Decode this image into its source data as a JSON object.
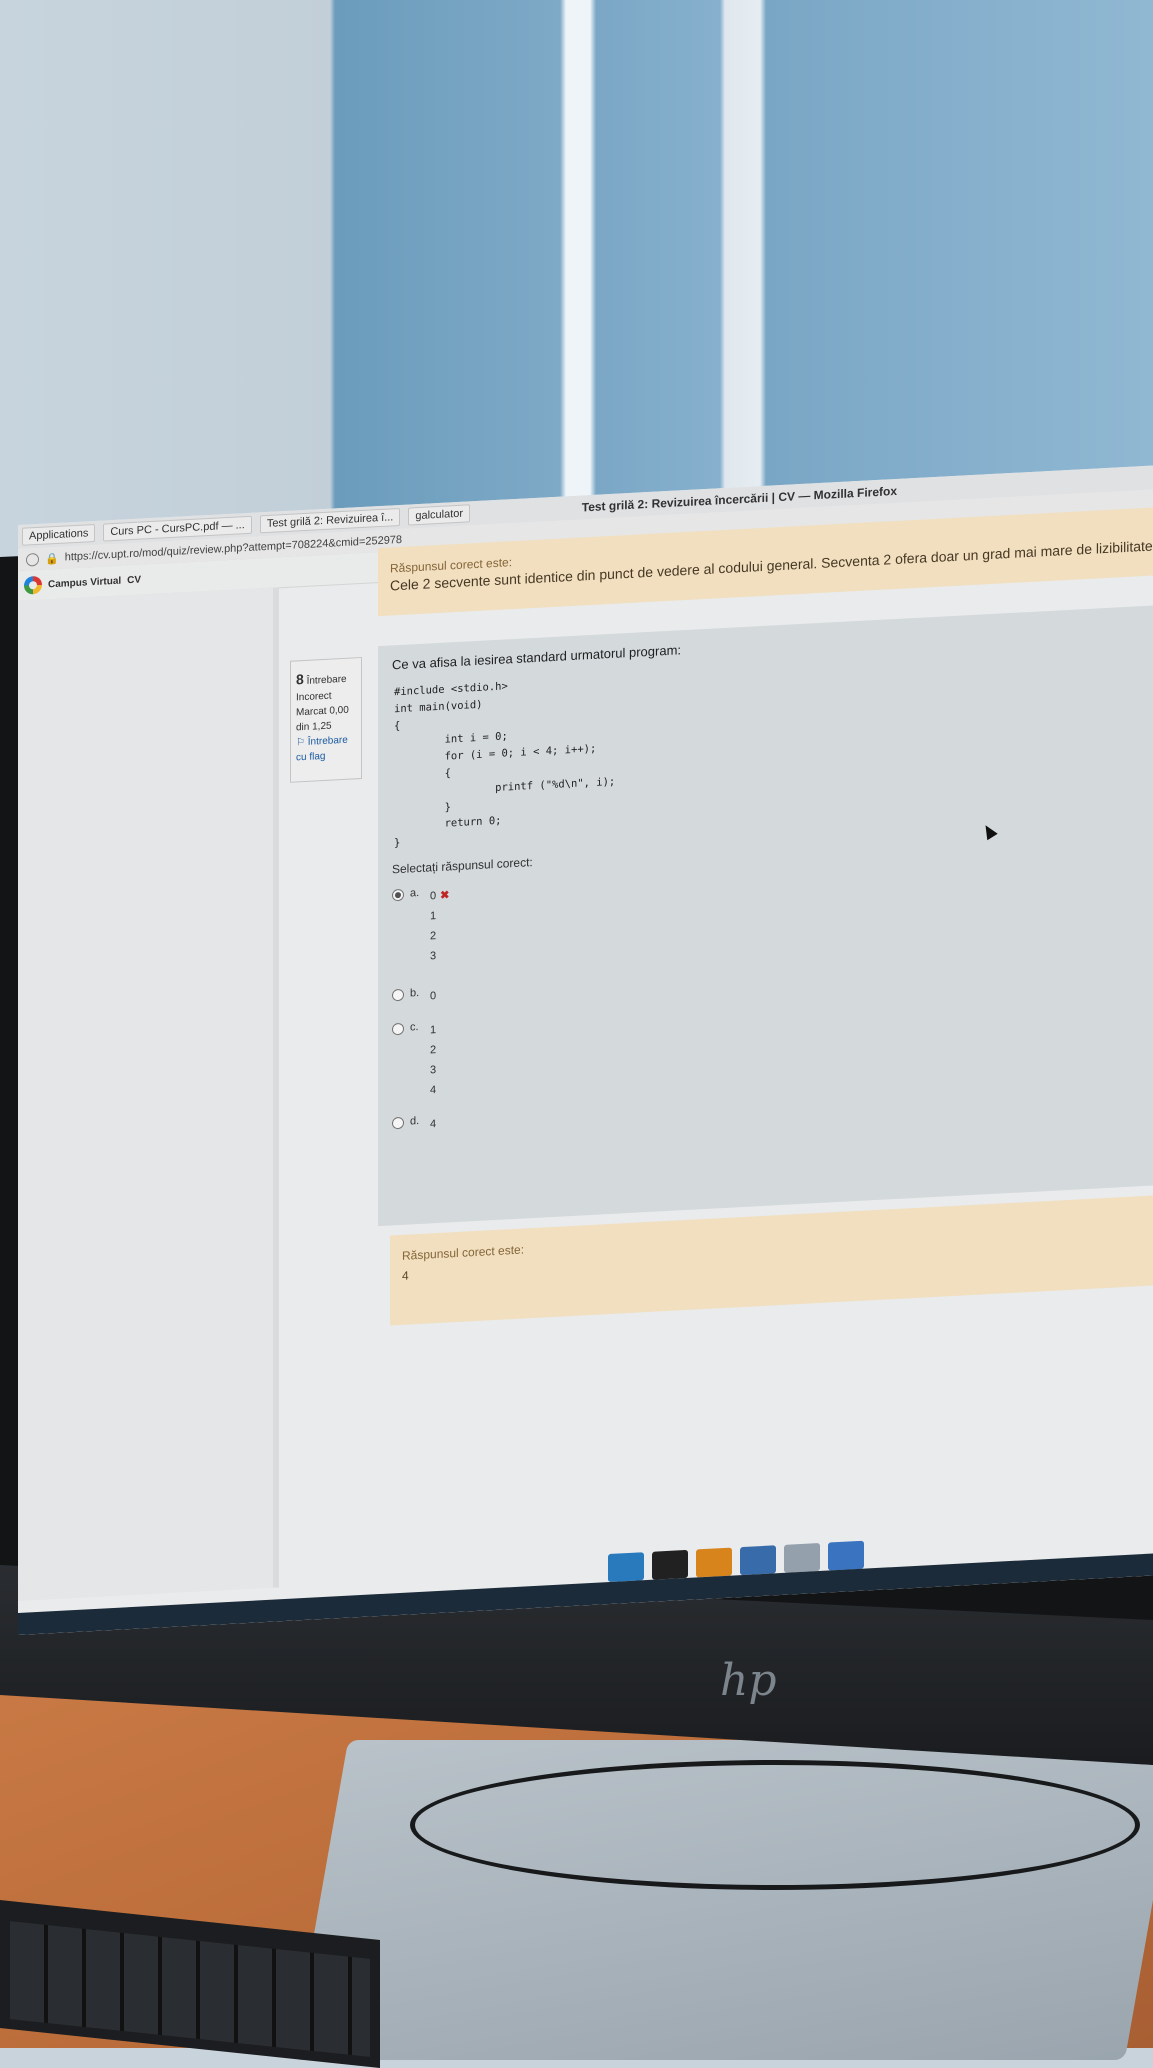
{
  "taskbar": {
    "applications": "Applications",
    "tab_1": "Curs PC - CursPC.pdf — ...",
    "tab_2": "Test grilă 2: Revizuirea î...",
    "tab_3": "galculator",
    "window_title": "Test grilă 2: Revizuirea încercării | CV — Mozilla Firefox"
  },
  "browser": {
    "url": "https://cv.upt.ro/mod/quiz/review.php?attempt=708224&cmid=252978"
  },
  "site": {
    "logo_text": "Campus Virtual",
    "logo_suffix": "CV"
  },
  "prev_feedback": {
    "label": "Răspunsul corect este:",
    "text": "Cele 2 secvente sunt identice din punct de vedere al codului general. Secventa 2 ofera doar un grad mai mare de lizibilitate"
  },
  "question_info": {
    "number": "8",
    "number_label": "Întrebare",
    "state": "Incorect",
    "mark": "Marcat 0,00 din 1,25",
    "flag": "Întrebare cu flag"
  },
  "question": {
    "text": "Ce va afisa la iesirea standard urmatorul program:",
    "code": "#include <stdio.h>\nint main(void)\n{\n        int i = 0;\n        for (i = 0; i < 4; i++);\n        {\n                printf (\"%d\\n\", i);\n        }\n        return 0;\n}",
    "prompt": "Selectați răspunsul corect:",
    "options": [
      {
        "letter": "a.",
        "values": [
          "0",
          "1",
          "2",
          "3"
        ],
        "selected": true,
        "wrong_mark": "✖"
      },
      {
        "letter": "b.",
        "values": [
          "0"
        ],
        "selected": false
      },
      {
        "letter": "c.",
        "values": [
          "1",
          "2",
          "3",
          "4"
        ],
        "selected": false
      },
      {
        "letter": "d.",
        "values": [
          "4"
        ],
        "selected": false
      }
    ]
  },
  "answer": {
    "label": "Răspunsul corect este:",
    "value": "4"
  },
  "monitor_brand": "hp"
}
